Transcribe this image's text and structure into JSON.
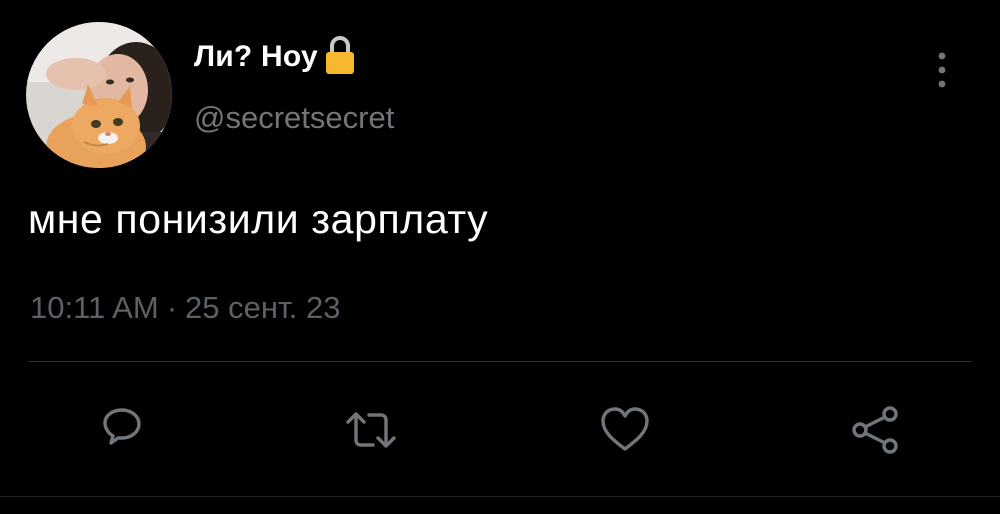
{
  "tweet": {
    "author": {
      "display_name": "Ли? Ноу",
      "handle": "@secretsecret",
      "avatar": "avatar-photo-person-with-cat",
      "protected_icon": "lock-icon"
    },
    "text": "мне понизили зарплату",
    "time": "10:11 AM",
    "separator": "·",
    "date": "25 сент. 23",
    "more_icon": "more-vertical-icon"
  },
  "actions": [
    {
      "name": "reply",
      "icon": "reply-icon"
    },
    {
      "name": "retweet",
      "icon": "retweet-icon"
    },
    {
      "name": "like",
      "icon": "heart-icon"
    },
    {
      "name": "share",
      "icon": "share-icon"
    }
  ],
  "colors": {
    "background": "#000000",
    "text_primary": "#ffffff",
    "text_secondary": "#71767b",
    "icon": "#71767b",
    "divider": "#2f3336",
    "lock": "#f5b82e"
  }
}
